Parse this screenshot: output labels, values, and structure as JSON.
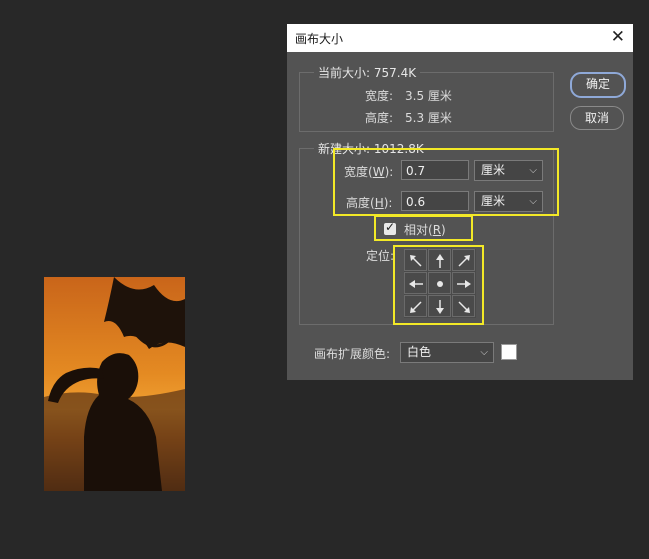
{
  "dialog": {
    "title": "画布大小",
    "close_glyph": "✕"
  },
  "current_size": {
    "legend": "当前大小: 757.4K",
    "width_label": "宽度:",
    "width_value": "3.5 厘米",
    "height_label": "高度:",
    "height_value": "5.3 厘米"
  },
  "buttons": {
    "ok": "确定",
    "cancel": "取消"
  },
  "new_size": {
    "legend": "新建大小: 1012.8K",
    "width_label_prefix": "宽度(",
    "width_label_key": "W",
    "width_label_suffix": "):",
    "width_value": "0.7",
    "width_unit": "厘米",
    "height_label_prefix": "高度(",
    "height_label_key": "H",
    "height_label_suffix": "):",
    "height_value": "0.6",
    "height_unit": "厘米",
    "relative_prefix": "相对(",
    "relative_key": "R",
    "relative_suffix": ")",
    "relative_checked": true,
    "anchor_label": "定位:"
  },
  "extension_color": {
    "label": "画布扩展颜色:",
    "value": "白色",
    "swatch_color": "#ffffff"
  },
  "highlight_color": "#f3e927",
  "icons": [
    "close-icon",
    "chevron-down-icon",
    "check-icon",
    "arrow-nw-icon",
    "arrow-n-icon",
    "arrow-ne-icon",
    "arrow-w-icon",
    "anchor-dot-icon",
    "arrow-e-icon",
    "arrow-sw-icon",
    "arrow-s-icon",
    "arrow-se-icon"
  ]
}
